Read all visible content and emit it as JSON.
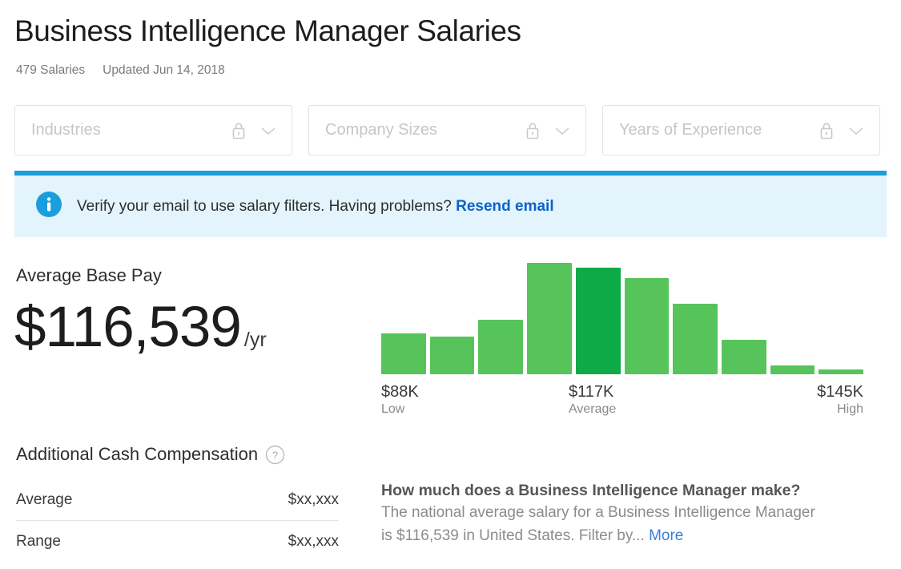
{
  "header": {
    "title": "Business Intelligence Manager Salaries",
    "salary_count": "479 Salaries",
    "updated": "Updated Jun 14, 2018"
  },
  "filters": [
    {
      "label": "Industries",
      "icon": "lock-icon",
      "chevron": "chevron-down-icon",
      "locked": true
    },
    {
      "label": "Company Sizes",
      "icon": "lock-icon",
      "chevron": "chevron-down-icon",
      "locked": true
    },
    {
      "label": "Years of Experience",
      "icon": "lock-icon",
      "chevron": "chevron-down-icon",
      "locked": true
    }
  ],
  "banner": {
    "icon": "info-circle-icon",
    "message": "Verify your email to use salary filters. Having problems? ",
    "link_label": "Resend email",
    "accent_color": "#1a9fdc",
    "background_color": "#e3f4fd",
    "link_color": "#0c62c7"
  },
  "base_pay": {
    "label": "Average Base Pay",
    "amount": "$116,539",
    "unit": "/yr"
  },
  "additional_cash": {
    "heading": "Additional Cash Compensation",
    "help_icon": "question-circle-icon",
    "rows": [
      {
        "label": "Average",
        "value": "$xx,xxx"
      },
      {
        "label": "Range",
        "value": "$xx,xxx"
      }
    ]
  },
  "description": {
    "title": "How much does a Business Intelligence Manager make?",
    "body": "The national average salary for a Business Intelligence Manager is $116,539 in United States. Filter by... ",
    "more_label": "More"
  },
  "chart_data": {
    "type": "bar",
    "title": "Base pay salary distribution",
    "xlabel": "",
    "ylabel": "",
    "grid": false,
    "legend": false,
    "bar_color": "#56c45a",
    "highlight_color": "#0eaa47",
    "highlight_index": 4,
    "categories": [
      "b1",
      "b2",
      "b3",
      "b4",
      "b5",
      "b6",
      "b7",
      "b8",
      "b9",
      "b10"
    ],
    "values": [
      37,
      34,
      49,
      100,
      96,
      86,
      63,
      31,
      8,
      4
    ],
    "ylim": [
      0,
      100
    ],
    "axis_labels": [
      {
        "value": "$88K",
        "name": "Low"
      },
      {
        "value": "$117K",
        "name": "Average"
      },
      {
        "value": "$145K",
        "name": "High"
      }
    ]
  }
}
